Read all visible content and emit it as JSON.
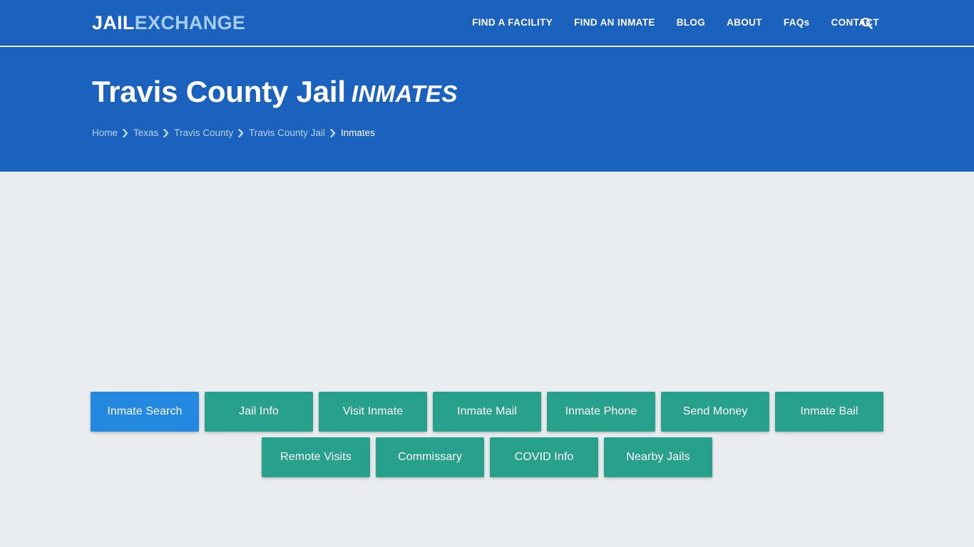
{
  "navbar": {
    "logo": {
      "part1": "JAIL",
      "part2": "EXCHANGE",
      "color_part1": "#ffffff",
      "color_part2": "#a6cdee"
    },
    "links": [
      {
        "label": "FIND A FACILITY"
      },
      {
        "label": "FIND AN INMATE"
      },
      {
        "label": "BLOG"
      },
      {
        "label": "ABOUT"
      },
      {
        "label": "FAQs"
      },
      {
        "label": "CONTACT"
      }
    ],
    "search_icon": "search-icon",
    "background_color": "#1b62bf"
  },
  "hero": {
    "title_main": "Travis County Jail",
    "title_sub": "INMATES",
    "background_color": "#1b62bf",
    "breadcrumb": [
      {
        "label": "Home",
        "current": false
      },
      {
        "label": "Texas",
        "current": false
      },
      {
        "label": "Travis County",
        "current": false
      },
      {
        "label": "Travis County Jail",
        "current": false
      },
      {
        "label": "Inmates",
        "current": true
      }
    ]
  },
  "actions": {
    "active_color": "#2389e0",
    "default_color": "#27a08c",
    "row1": [
      {
        "label": "Inmate Search",
        "active": true
      },
      {
        "label": "Jail Info",
        "active": false
      },
      {
        "label": "Visit Inmate",
        "active": false
      },
      {
        "label": "Inmate Mail",
        "active": false
      },
      {
        "label": "Inmate Phone",
        "active": false
      },
      {
        "label": "Send Money",
        "active": false
      },
      {
        "label": "Inmate Bail",
        "active": false
      }
    ],
    "row2": [
      {
        "label": "Remote Visits",
        "active": false
      },
      {
        "label": "Commissary",
        "active": false
      },
      {
        "label": "COVID Info",
        "active": false
      },
      {
        "label": "Nearby Jails",
        "active": false
      }
    ]
  },
  "page": {
    "background_color": "#eaedf0"
  }
}
